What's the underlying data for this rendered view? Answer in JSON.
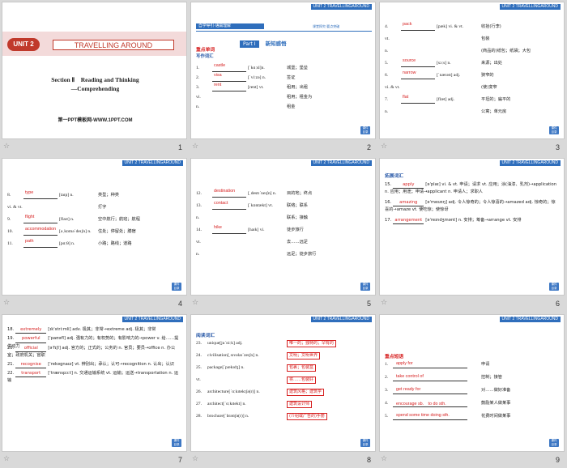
{
  "colors": {
    "accent": "#2f6ebc",
    "answer": "#d62020",
    "cover_red": "#c0392b"
  },
  "unit_banner": "UNIT 2  TRAVELLINGAROUND",
  "badge_text": "课件\n目录",
  "slides": {
    "s1": {
      "num": "1",
      "unit": "UNIT 2",
      "title": "TRAVELLING AROUND",
      "section": "Section Ⅱ　Reading and Thinking",
      "section2": "—Comprehending",
      "site": "第一PPT模板网-WWW.1PPT.COM"
    },
    "s2": {
      "num": "2",
      "nav": "自学导引·语篇理解",
      "nav2": "课堂探究·要点突破",
      "part": "Part Ⅰ",
      "part_title": "新知感悟",
      "heading": "重点单词",
      "sub": "写作词汇",
      "rows": [
        {
          "n": "1.",
          "ans": "castle",
          "ph": "[ˈkɑːsl]n.",
          "cn": "城堡；堡垒"
        },
        {
          "n": "2.",
          "ans": "visa",
          "ph": "[ˈviːzə] n.",
          "cn": "签证"
        },
        {
          "n": "3.",
          "ans": "rent",
          "ph": "[rent] vt.",
          "cn": "租用；出租"
        },
        {
          "n": "vi.",
          "ans": "",
          "ph": "",
          "cn": "租用；租金为"
        },
        {
          "n": "n.",
          "ans": "",
          "ph": "",
          "cn": "租金"
        }
      ]
    },
    "s3": {
      "num": "3",
      "rows": [
        {
          "n": "4.",
          "ans": "pack",
          "ph": "[pæk] vi. & vt.",
          "cn": "收拾(行李)"
        },
        {
          "n": "vt.",
          "ans": "",
          "ph": "",
          "cn": "包装"
        },
        {
          "n": "n.",
          "ans": "",
          "ph": "",
          "cn": "(商品的)纸包；纸袋；大包"
        },
        {
          "n": "5.",
          "ans": "source",
          "ph": "[sɔːs] n.",
          "cn": "来源；出处"
        },
        {
          "n": "6.",
          "ans": "narrow",
          "ph": "[ˈnærəʊ] adj.",
          "cn": "狭窄的"
        },
        {
          "n": "vi. & vt.",
          "ans": "",
          "ph": "",
          "cn": "(使)变窄"
        },
        {
          "n": "7.",
          "ans": "flat",
          "ph": "[flæt] adj.",
          "cn": "平坦的；扁平的"
        },
        {
          "n": "n.",
          "ans": "",
          "ph": "",
          "cn": "公寓；单元房"
        }
      ]
    },
    "s4": {
      "num": "4",
      "rows": [
        {
          "n": "8.",
          "ans": "type",
          "ph": "[taɪp] n.",
          "cn": "类型；种类"
        },
        {
          "n": "vi. & vt.",
          "ans": "",
          "ph": "",
          "cn": "打字"
        },
        {
          "n": "9.",
          "ans": "flight",
          "ph": "[flaɪt] n.",
          "cn": "空中航行；航班；航程"
        },
        {
          "n": "10.",
          "ans": "accommodation",
          "ph": "[əˌkɒməˈdeɪʃn] n.",
          "cn": "住处；停留处；膳宿"
        },
        {
          "n": "11.",
          "ans": "path",
          "ph": "[pɑːθ] n.",
          "cn": "小路；路线；道路"
        }
      ]
    },
    "s5": {
      "num": "5",
      "rows": [
        {
          "n": "12.",
          "ans": "destination",
          "ph": "[ˌdestɪˈneɪʃn] n.",
          "cn": "目的地；终点"
        },
        {
          "n": "13.",
          "ans": "contact",
          "ph": "[ˈkɒntækt] vt.",
          "cn": "联络；联系"
        },
        {
          "n": "n.",
          "ans": "",
          "ph": "",
          "cn": "联系；接触"
        },
        {
          "n": "14.",
          "ans": "hike",
          "ph": "[haɪk] vi.",
          "cn": "徒步旅行"
        },
        {
          "n": "vt.",
          "ans": "",
          "ph": "",
          "cn": "去……远足"
        },
        {
          "n": "n.",
          "ans": "",
          "ph": "",
          "cn": "远足；徒步旅行"
        }
      ]
    },
    "s6": {
      "num": "6",
      "heading": "拓展词汇",
      "rows": [
        {
          "n": "15.",
          "ans": "apply",
          "text": "[əˈplaɪ] vi. & vt. 申请；请求 vt. 应用；涂(油漆、乳剂)→application n. 应用；用途；申请→applicant n. 申请人；求职人"
        },
        {
          "n": "16.",
          "ans": "amazing",
          "text": "[əˈmeɪzɪŋ] adj. 令人惊奇的；令人惊喜的→amazed adj. 惊奇的；惊喜的→amaze vt. 使吃惊；使惊讶"
        },
        {
          "n": "17.",
          "ans": "arrangement",
          "text": "[əˈreɪndʒmənt] n. 安排；筹备→arrange vt. 安排"
        }
      ]
    },
    "s7": {
      "num": "7",
      "rows": [
        {
          "n": "18.",
          "ans": "extremely",
          "text": "[ɪkˈstriːmli] adv. 极其；非常→extreme adj. 极其；非常"
        },
        {
          "n": "19.",
          "ans": "powerful",
          "text": "[ˈpaʊəfl] adj. 强有力的；有权势的；有影响力的→power v. 给……提供动力"
        },
        {
          "n": "20.",
          "ans": "official",
          "text": "[əˈfɪʃl] adj. 官方的；正式的；公务的 n. 官员；要员→office n. 办公室；政府机关；官职"
        },
        {
          "n": "21.",
          "ans": "recognise",
          "text": "[ˈrekəgnaɪz] vt. 辨别出；承认；认可→recognition n. 认出；认识"
        },
        {
          "n": "22.",
          "ans": "transport",
          "text": "[ˈtrænspɔːt] n. 交通运输系统 vt. 运输；运送→transportation n. 运输"
        }
      ]
    },
    "s8": {
      "num": "8",
      "heading": "阅读词汇",
      "rows": [
        {
          "n": "23.",
          "w": "unique[juˈniːk] adj.",
          "cn": "唯一的；独特的；罕有的"
        },
        {
          "n": "24.",
          "w": "civilisation[ˌsɪvəlaɪˈzeɪʃn] n.",
          "cn": "文明；文明世界"
        },
        {
          "n": "25.",
          "w": "package[ˈpækɪdʒ] n.",
          "cn": "包裹；包装盒"
        },
        {
          "n": "vt.",
          "w": "",
          "cn": "将……包装好"
        },
        {
          "n": "26.",
          "w": "architecture[ˈɑːkɪtektʃə(r)] n.",
          "cn": "建筑风格；建筑学"
        },
        {
          "n": "27.",
          "w": "architect[ˈɑːkɪtekt] n.",
          "cn": "建筑设计师"
        },
        {
          "n": "28.",
          "w": "brochure[ˈbrəʊʃə(r)] n.",
          "cn": "(介绍或广告的)手册"
        }
      ]
    },
    "s9": {
      "num": "9",
      "heading": "重点短语",
      "rows": [
        {
          "n": "1.",
          "ans": "apply for",
          "cn": "申请"
        },
        {
          "n": "2.",
          "ans": "take control of",
          "cn": "控制；接管"
        },
        {
          "n": "3.",
          "ans": "get ready for",
          "cn": "对……做好准备"
        },
        {
          "n": "4.",
          "ans": "encourage sb.　to do sth.",
          "cn": "鼓励某人做某事"
        },
        {
          "n": "5.",
          "ans": "spend some time doing sth.",
          "cn": "花费时间做某事"
        }
      ]
    }
  }
}
